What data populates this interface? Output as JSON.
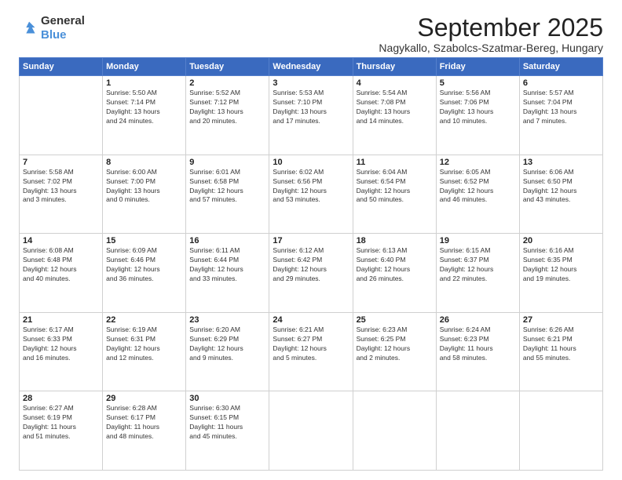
{
  "logo": {
    "general": "General",
    "blue": "Blue"
  },
  "header": {
    "month": "September 2025",
    "location": "Nagykallo, Szabolcs-Szatmar-Bereg, Hungary"
  },
  "weekdays": [
    "Sunday",
    "Monday",
    "Tuesday",
    "Wednesday",
    "Thursday",
    "Friday",
    "Saturday"
  ],
  "weeks": [
    [
      {
        "day": "",
        "info": ""
      },
      {
        "day": "1",
        "info": "Sunrise: 5:50 AM\nSunset: 7:14 PM\nDaylight: 13 hours\nand 24 minutes."
      },
      {
        "day": "2",
        "info": "Sunrise: 5:52 AM\nSunset: 7:12 PM\nDaylight: 13 hours\nand 20 minutes."
      },
      {
        "day": "3",
        "info": "Sunrise: 5:53 AM\nSunset: 7:10 PM\nDaylight: 13 hours\nand 17 minutes."
      },
      {
        "day": "4",
        "info": "Sunrise: 5:54 AM\nSunset: 7:08 PM\nDaylight: 13 hours\nand 14 minutes."
      },
      {
        "day": "5",
        "info": "Sunrise: 5:56 AM\nSunset: 7:06 PM\nDaylight: 13 hours\nand 10 minutes."
      },
      {
        "day": "6",
        "info": "Sunrise: 5:57 AM\nSunset: 7:04 PM\nDaylight: 13 hours\nand 7 minutes."
      }
    ],
    [
      {
        "day": "7",
        "info": "Sunrise: 5:58 AM\nSunset: 7:02 PM\nDaylight: 13 hours\nand 3 minutes."
      },
      {
        "day": "8",
        "info": "Sunrise: 6:00 AM\nSunset: 7:00 PM\nDaylight: 13 hours\nand 0 minutes."
      },
      {
        "day": "9",
        "info": "Sunrise: 6:01 AM\nSunset: 6:58 PM\nDaylight: 12 hours\nand 57 minutes."
      },
      {
        "day": "10",
        "info": "Sunrise: 6:02 AM\nSunset: 6:56 PM\nDaylight: 12 hours\nand 53 minutes."
      },
      {
        "day": "11",
        "info": "Sunrise: 6:04 AM\nSunset: 6:54 PM\nDaylight: 12 hours\nand 50 minutes."
      },
      {
        "day": "12",
        "info": "Sunrise: 6:05 AM\nSunset: 6:52 PM\nDaylight: 12 hours\nand 46 minutes."
      },
      {
        "day": "13",
        "info": "Sunrise: 6:06 AM\nSunset: 6:50 PM\nDaylight: 12 hours\nand 43 minutes."
      }
    ],
    [
      {
        "day": "14",
        "info": "Sunrise: 6:08 AM\nSunset: 6:48 PM\nDaylight: 12 hours\nand 40 minutes."
      },
      {
        "day": "15",
        "info": "Sunrise: 6:09 AM\nSunset: 6:46 PM\nDaylight: 12 hours\nand 36 minutes."
      },
      {
        "day": "16",
        "info": "Sunrise: 6:11 AM\nSunset: 6:44 PM\nDaylight: 12 hours\nand 33 minutes."
      },
      {
        "day": "17",
        "info": "Sunrise: 6:12 AM\nSunset: 6:42 PM\nDaylight: 12 hours\nand 29 minutes."
      },
      {
        "day": "18",
        "info": "Sunrise: 6:13 AM\nSunset: 6:40 PM\nDaylight: 12 hours\nand 26 minutes."
      },
      {
        "day": "19",
        "info": "Sunrise: 6:15 AM\nSunset: 6:37 PM\nDaylight: 12 hours\nand 22 minutes."
      },
      {
        "day": "20",
        "info": "Sunrise: 6:16 AM\nSunset: 6:35 PM\nDaylight: 12 hours\nand 19 minutes."
      }
    ],
    [
      {
        "day": "21",
        "info": "Sunrise: 6:17 AM\nSunset: 6:33 PM\nDaylight: 12 hours\nand 16 minutes."
      },
      {
        "day": "22",
        "info": "Sunrise: 6:19 AM\nSunset: 6:31 PM\nDaylight: 12 hours\nand 12 minutes."
      },
      {
        "day": "23",
        "info": "Sunrise: 6:20 AM\nSunset: 6:29 PM\nDaylight: 12 hours\nand 9 minutes."
      },
      {
        "day": "24",
        "info": "Sunrise: 6:21 AM\nSunset: 6:27 PM\nDaylight: 12 hours\nand 5 minutes."
      },
      {
        "day": "25",
        "info": "Sunrise: 6:23 AM\nSunset: 6:25 PM\nDaylight: 12 hours\nand 2 minutes."
      },
      {
        "day": "26",
        "info": "Sunrise: 6:24 AM\nSunset: 6:23 PM\nDaylight: 11 hours\nand 58 minutes."
      },
      {
        "day": "27",
        "info": "Sunrise: 6:26 AM\nSunset: 6:21 PM\nDaylight: 11 hours\nand 55 minutes."
      }
    ],
    [
      {
        "day": "28",
        "info": "Sunrise: 6:27 AM\nSunset: 6:19 PM\nDaylight: 11 hours\nand 51 minutes."
      },
      {
        "day": "29",
        "info": "Sunrise: 6:28 AM\nSunset: 6:17 PM\nDaylight: 11 hours\nand 48 minutes."
      },
      {
        "day": "30",
        "info": "Sunrise: 6:30 AM\nSunset: 6:15 PM\nDaylight: 11 hours\nand 45 minutes."
      },
      {
        "day": "",
        "info": ""
      },
      {
        "day": "",
        "info": ""
      },
      {
        "day": "",
        "info": ""
      },
      {
        "day": "",
        "info": ""
      }
    ]
  ]
}
